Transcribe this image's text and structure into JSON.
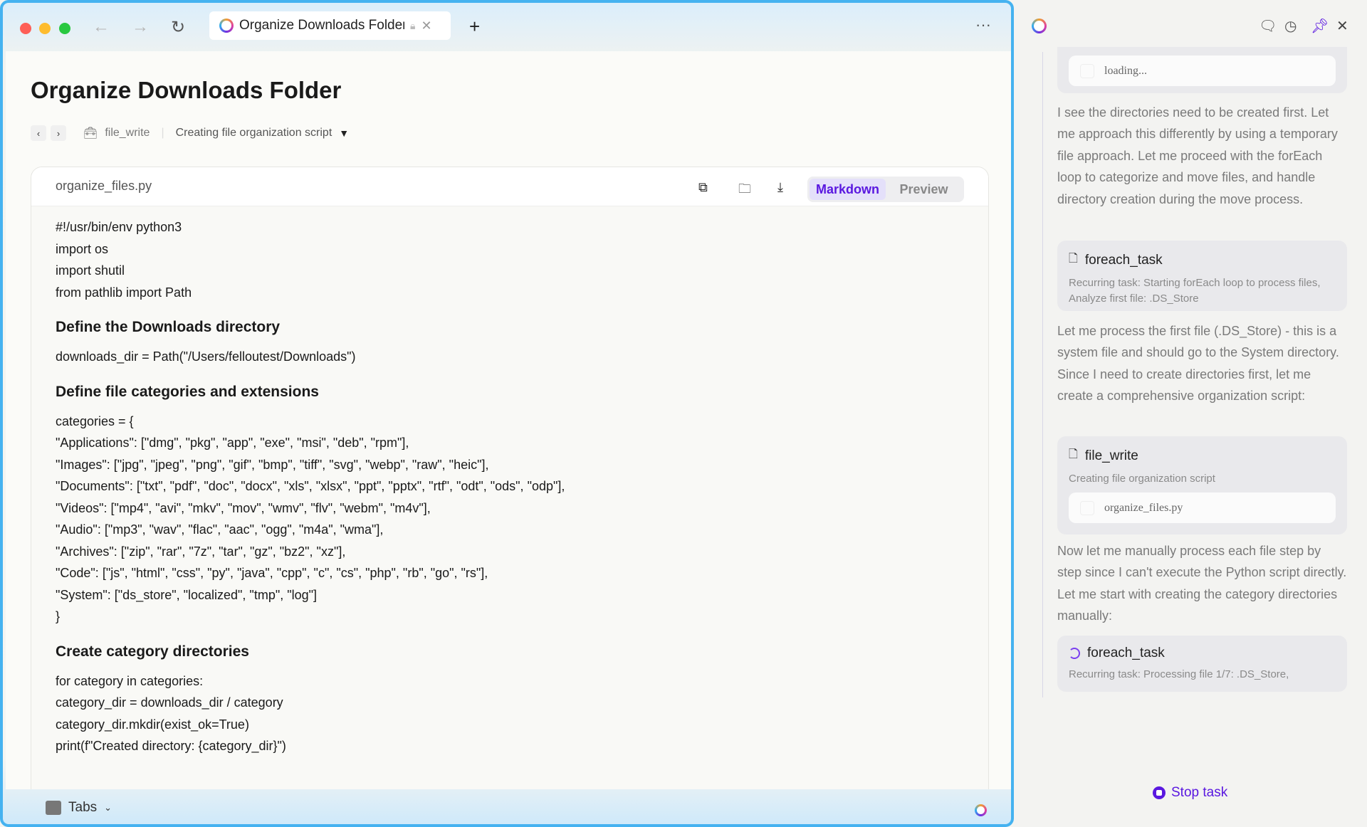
{
  "browser": {
    "tab_title": "Organize Downloads Folder",
    "new_tab": "+",
    "more": "···"
  },
  "page": {
    "title": "Organize Downloads Folder",
    "breadcrumb": {
      "tool": "file_write",
      "step": "Creating file organization script"
    }
  },
  "file_card": {
    "filename": "organize_files.py",
    "modes": [
      "Markdown",
      "Preview"
    ],
    "active_mode": "Markdown",
    "content": [
      {
        "t": "l",
        "v": "#!/usr/bin/env python3"
      },
      {
        "t": "l",
        "v": "import os"
      },
      {
        "t": "l",
        "v": "import shutil"
      },
      {
        "t": "l",
        "v": "from pathlib import Path"
      },
      {
        "t": "h",
        "v": "Define the Downloads directory"
      },
      {
        "t": "l",
        "v": "downloads_dir = Path(\"/Users/felloutest/Downloads\")"
      },
      {
        "t": "h",
        "v": "Define file categories and extensions"
      },
      {
        "t": "l",
        "v": "categories = {"
      },
      {
        "t": "l",
        "v": "\"Applications\": [\"dmg\", \"pkg\", \"app\", \"exe\", \"msi\", \"deb\", \"rpm\"],"
      },
      {
        "t": "l",
        "v": "\"Images\": [\"jpg\", \"jpeg\", \"png\", \"gif\", \"bmp\", \"tiff\", \"svg\", \"webp\", \"raw\", \"heic\"],"
      },
      {
        "t": "l",
        "v": "\"Documents\": [\"txt\", \"pdf\", \"doc\", \"docx\", \"xls\", \"xlsx\", \"ppt\", \"pptx\", \"rtf\", \"odt\", \"ods\", \"odp\"],"
      },
      {
        "t": "l",
        "v": "\"Videos\": [\"mp4\", \"avi\", \"mkv\", \"mov\", \"wmv\", \"flv\", \"webm\", \"m4v\"],"
      },
      {
        "t": "l",
        "v": "\"Audio\": [\"mp3\", \"wav\", \"flac\", \"aac\", \"ogg\", \"m4a\", \"wma\"],"
      },
      {
        "t": "l",
        "v": "\"Archives\": [\"zip\", \"rar\", \"7z\", \"tar\", \"gz\", \"bz2\", \"xz\"],"
      },
      {
        "t": "l",
        "v": "\"Code\": [\"js\", \"html\", \"css\", \"py\", \"java\", \"cpp\", \"c\", \"cs\", \"php\", \"rb\", \"go\", \"rs\"],"
      },
      {
        "t": "l",
        "v": "\"System\": [\"ds_store\", \"localized\", \"tmp\", \"log\"]"
      },
      {
        "t": "l",
        "v": "}"
      },
      {
        "t": "h",
        "v": "Create category directories"
      },
      {
        "t": "l",
        "v": "for category in categories:"
      },
      {
        "t": "l",
        "v": "category_dir = downloads_dir / category"
      },
      {
        "t": "l",
        "v": "category_dir.mkdir(exist_ok=True)"
      },
      {
        "t": "l",
        "v": "print(f\"Created directory: {category_dir}\")"
      }
    ]
  },
  "bottom_bar": {
    "tabs_label": "Tabs"
  },
  "panel": {
    "loading": "loading...",
    "para1": "I see the directories need to be created first. Let me approach this differently by using a temporary file approach. Let me proceed with the forEach loop to categorize and move files, and handle directory creation during the move process.",
    "task1": {
      "title": "foreach_task",
      "desc": "Recurring task: Starting forEach loop to process files, Analyze first file: .DS_Store"
    },
    "para2": "Let me process the first file (.DS_Store) - this is a system file and should go to the System directory. Since I need to create directories first, let me create a comprehensive organization script:",
    "task2": {
      "title": "file_write",
      "desc": "Creating file organization script",
      "file": "organize_files.py"
    },
    "para3": "Now let me manually process each file step by step since I can't execute the Python script directly. Let me start with creating the category directories manually:",
    "task3": {
      "title": "foreach_task",
      "desc": "Recurring task: Processing file 1/7: .DS_Store,"
    },
    "stop_label": "Stop task"
  },
  "colors": {
    "accent": "#5a18e0",
    "window_border": "#45b2f0"
  }
}
